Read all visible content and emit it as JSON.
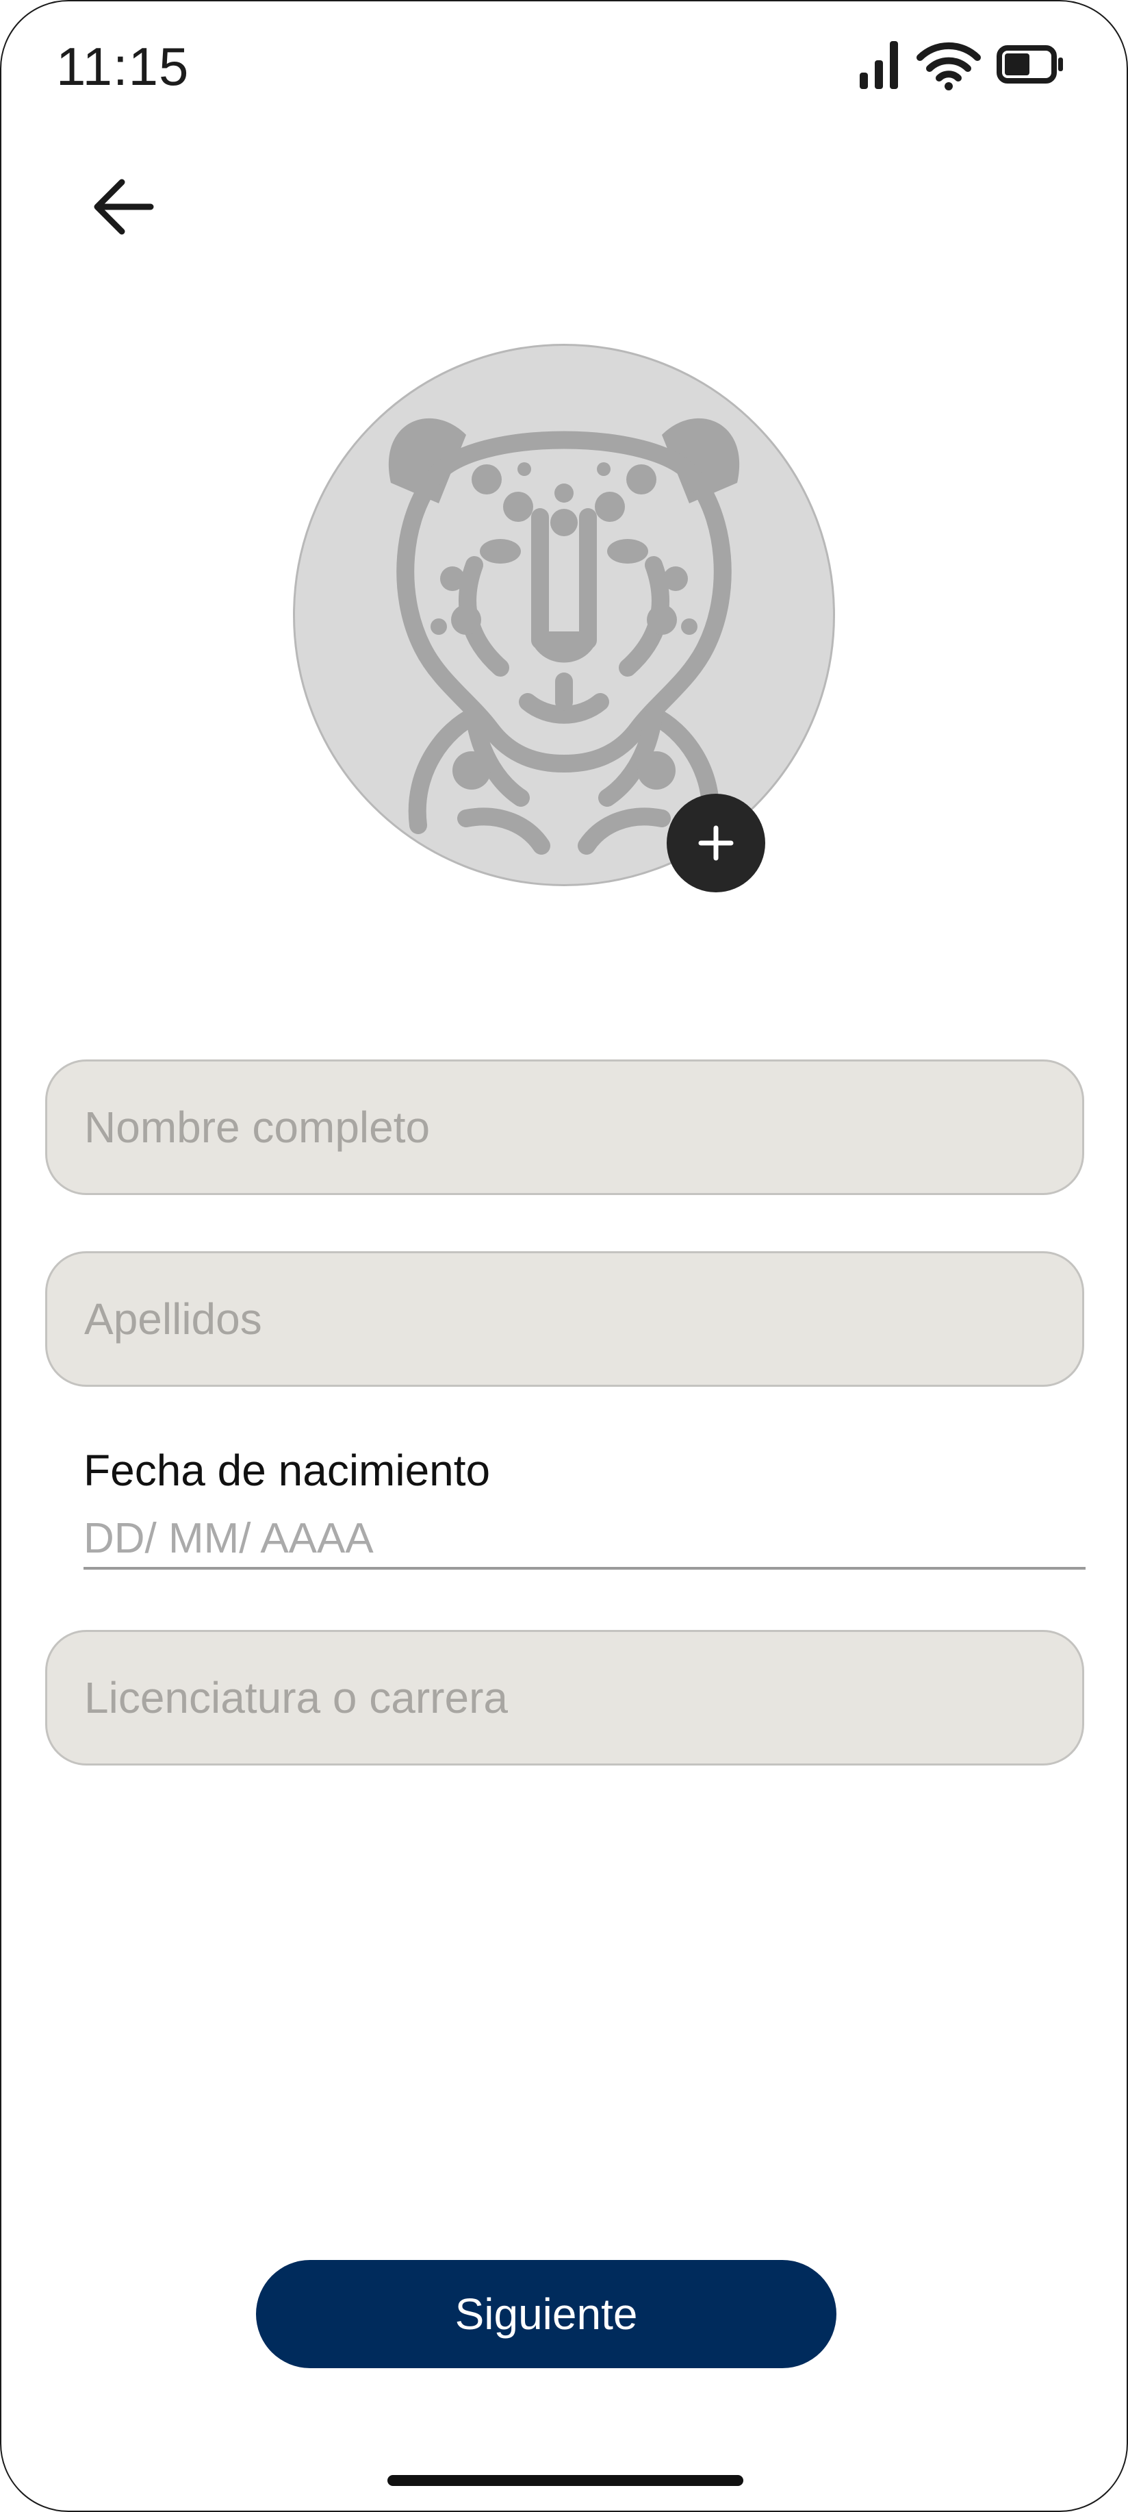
{
  "status_bar": {
    "time": "11:15",
    "icons": [
      "cellular-signal-icon",
      "wifi-icon",
      "battery-icon"
    ]
  },
  "nav": {
    "back_icon": "arrow-left-icon"
  },
  "profile": {
    "avatar_icon": "cheetah-avatar-icon",
    "add_photo_icon": "plus-icon"
  },
  "form": {
    "full_name": {
      "value": "",
      "placeholder": "Nombre completo"
    },
    "last_names": {
      "value": "",
      "placeholder": "Apellidos"
    },
    "birth_date": {
      "label": "Fecha de nacimiento",
      "value": "",
      "placeholder": "DD/ MM/ AAAA"
    },
    "degree": {
      "value": "",
      "placeholder": "Licenciatura o carrera"
    }
  },
  "actions": {
    "next_label": "Siguiente"
  },
  "colors": {
    "primary": "#002b5c",
    "field_bg": "#e7e5e0",
    "avatar_bg": "#d9d9d9",
    "add_button": "#262626"
  }
}
